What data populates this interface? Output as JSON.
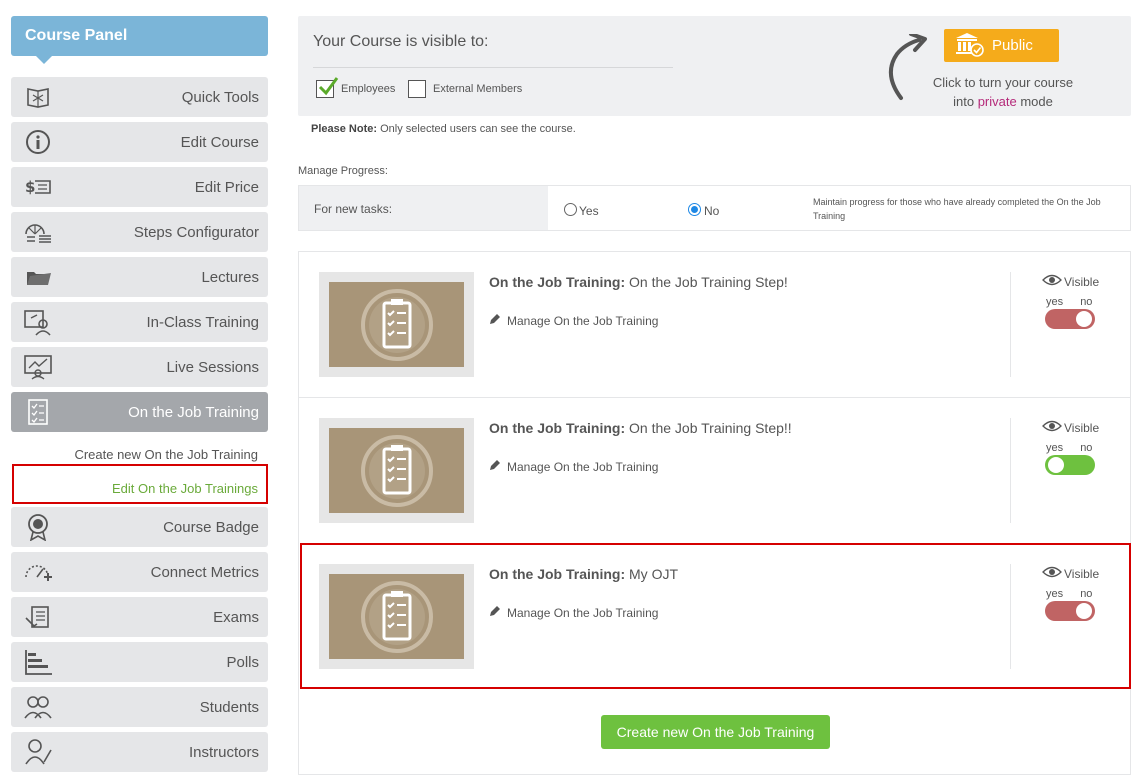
{
  "sidebar": {
    "title": "Course Panel",
    "menu_top": [
      {
        "label": "Quick Tools",
        "icon": "quick-tools-icon"
      },
      {
        "label": "Edit Course",
        "icon": "info-icon"
      },
      {
        "label": "Edit Price",
        "icon": "price-icon"
      },
      {
        "label": "Steps Configurator",
        "icon": "steps-icon"
      },
      {
        "label": "Lectures",
        "icon": "folder-icon"
      },
      {
        "label": "In-Class Training",
        "icon": "classroom-icon"
      },
      {
        "label": "Live Sessions",
        "icon": "live-session-icon"
      },
      {
        "label": "On the Job Training",
        "icon": "checklist-icon"
      }
    ],
    "sub_links": {
      "create": "Create new On the Job Training",
      "edit": "Edit On the Job Trainings"
    },
    "menu_bottom": [
      {
        "label": "Course Badge",
        "icon": "badge-icon"
      },
      {
        "label": "Connect Metrics",
        "icon": "metrics-icon"
      },
      {
        "label": "Exams",
        "icon": "exam-icon"
      },
      {
        "label": "Polls",
        "icon": "polls-icon"
      },
      {
        "label": "Students",
        "icon": "students-icon"
      },
      {
        "label": "Instructors",
        "icon": "instructor-icon"
      }
    ]
  },
  "visibility": {
    "title": "Your Course is visible to:",
    "employees_label": "Employees",
    "employees_checked": true,
    "external_label": "External Members",
    "external_checked": false,
    "public_button": "Public",
    "hint_line1": "Click to turn your course",
    "hint_pre": "into ",
    "hint_highlight": "private",
    "hint_post": " mode"
  },
  "note": {
    "bold": "Please Note:",
    "text": " Only selected users can see the course."
  },
  "progress": {
    "title": "Manage Progress:",
    "row_label": "For new tasks:",
    "yes_label": "Yes",
    "no_label": "No",
    "selected": "No",
    "description": "Maintain progress for those who have already completed the On the Job Training"
  },
  "trainings": [
    {
      "prefix": "On the Job Training:",
      "name": " On the Job Training Step!",
      "manage": "Manage On the Job Training",
      "visible_label": "Visible",
      "yes": "yes",
      "no": "no",
      "visible": false
    },
    {
      "prefix": "On the Job Training:",
      "name": " On the Job Training Step!!",
      "manage": "Manage On the Job Training",
      "visible_label": "Visible",
      "yes": "yes",
      "no": "no",
      "visible": true
    },
    {
      "prefix": "On the Job Training:",
      "name": " My OJT",
      "manage": "Manage On the Job Training",
      "visible_label": "Visible",
      "yes": "yes",
      "no": "no",
      "visible": false
    }
  ],
  "create_button": "Create new On the Job Training",
  "colors": {
    "sidebar_header": "#7bb5d8",
    "public_button": "#f5ab1b",
    "create_button": "#6ec13f",
    "toggle_off": "#c06464",
    "toggle_on": "#6ec13f",
    "highlight_box": "#d50000",
    "private_text": "#b52a7a"
  }
}
